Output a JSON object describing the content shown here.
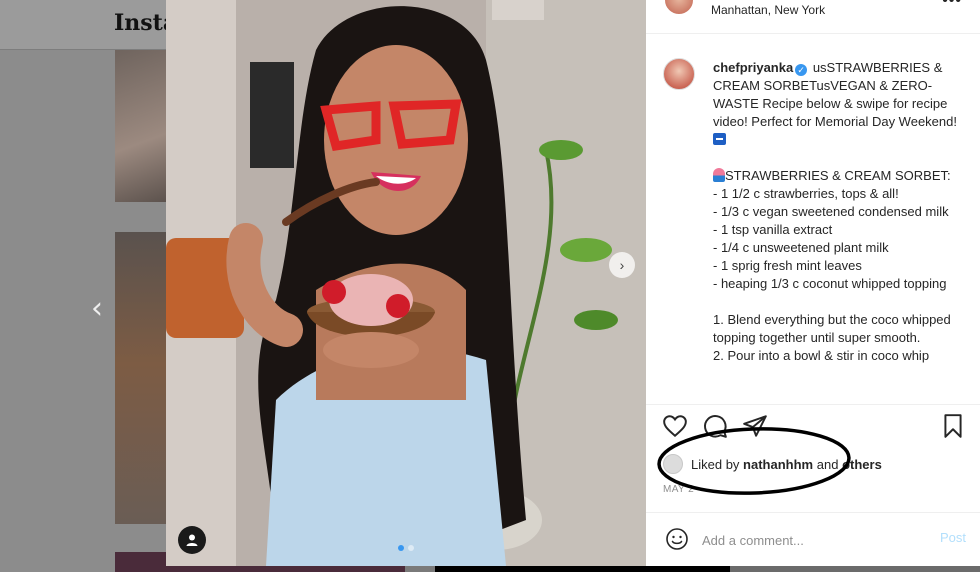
{
  "background": {
    "logo_text": "Insta",
    "prev_arrow": "‹"
  },
  "photo": {
    "next_arrow": "›",
    "slides_total": 2,
    "slide_active": 1
  },
  "post": {
    "location": "Manhattan, New York",
    "more_label": "•••",
    "username": "chefpriyanka",
    "caption_title": "usSTRAWBERRIES & CREAM SORBETusVEGAN & ZERO-WASTE Recipe below & swipe for recipe video! Perfect for Memorial Day Weekend!",
    "recipe_heading": "STRAWBERRIES & CREAM SORBET:",
    "ingredients": [
      "- 1 1/2 c strawberries, tops & all!",
      "- 1/3 c vegan sweetened condensed milk",
      "- 1 tsp vanilla extract",
      "- 1/4 c unsweetened plant milk",
      "- 1 sprig fresh mint leaves",
      "- heaping 1/3 c coconut whipped topping"
    ],
    "steps": [
      "1. Blend everything but the coco whipped topping together until super smooth.",
      "2. Pour into a bowl & stir in coco whip"
    ],
    "likes_prefix": "Liked by",
    "likes_user": "nathanhhm",
    "likes_and": "and",
    "likes_others": "others",
    "date": "MAY 2"
  },
  "comment": {
    "placeholder": "Add a comment...",
    "post_label": "Post"
  },
  "colors": {
    "accent": "#3897f0",
    "post_disabled": "#b2dffc",
    "annotation": "#000000"
  }
}
